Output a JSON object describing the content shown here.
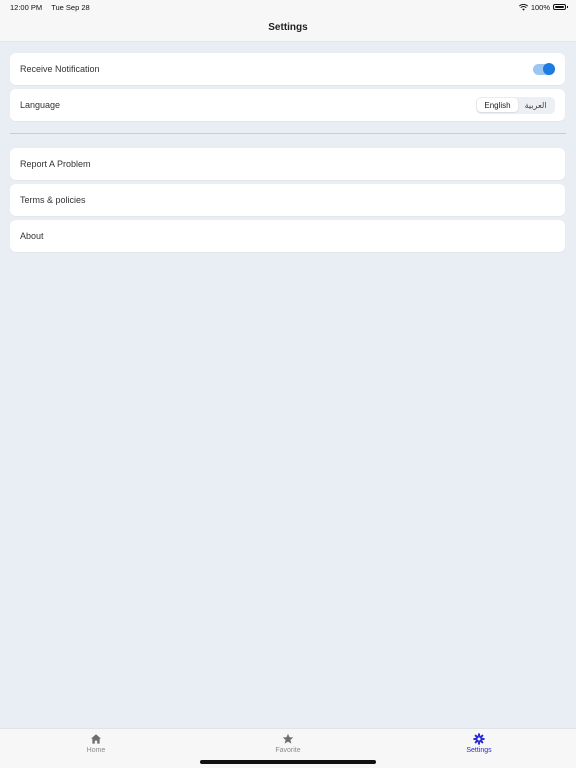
{
  "status_bar": {
    "time": "12:00 PM",
    "date": "Tue Sep 28",
    "battery": "100%",
    "icons": [
      "wifi-icon",
      "battery-icon"
    ]
  },
  "header": {
    "title": "Settings"
  },
  "settings": {
    "notification": {
      "label": "Receive Notification",
      "enabled": true
    },
    "language": {
      "label": "Language",
      "options": [
        "English",
        "العربية"
      ],
      "selected": "English"
    }
  },
  "links": [
    {
      "label": "Report A Problem"
    },
    {
      "label": "Terms & policies"
    },
    {
      "label": "About"
    }
  ],
  "tab_bar": {
    "tabs": [
      {
        "label": "Home",
        "icon": "home-icon"
      },
      {
        "label": "Favorite",
        "icon": "star-icon"
      },
      {
        "label": "Settings",
        "icon": "gear-icon",
        "active": true
      }
    ]
  },
  "colors": {
    "background": "#e9eef5",
    "accent": "#1e7be0",
    "tab_active": "#2a2ad6"
  }
}
